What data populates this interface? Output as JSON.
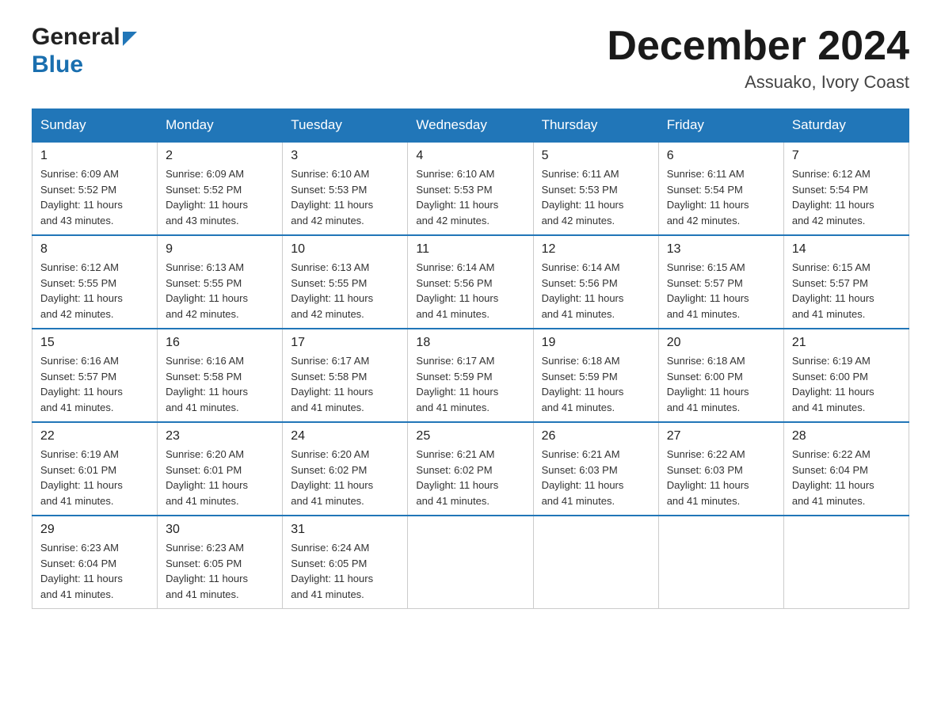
{
  "logo": {
    "general": "General",
    "blue": "Blue"
  },
  "header": {
    "month": "December 2024",
    "location": "Assuako, Ivory Coast"
  },
  "weekdays": [
    "Sunday",
    "Monday",
    "Tuesday",
    "Wednesday",
    "Thursday",
    "Friday",
    "Saturday"
  ],
  "weeks": [
    [
      {
        "day": "1",
        "sunrise": "6:09 AM",
        "sunset": "5:52 PM",
        "daylight": "11 hours and 43 minutes."
      },
      {
        "day": "2",
        "sunrise": "6:09 AM",
        "sunset": "5:52 PM",
        "daylight": "11 hours and 43 minutes."
      },
      {
        "day": "3",
        "sunrise": "6:10 AM",
        "sunset": "5:53 PM",
        "daylight": "11 hours and 42 minutes."
      },
      {
        "day": "4",
        "sunrise": "6:10 AM",
        "sunset": "5:53 PM",
        "daylight": "11 hours and 42 minutes."
      },
      {
        "day": "5",
        "sunrise": "6:11 AM",
        "sunset": "5:53 PM",
        "daylight": "11 hours and 42 minutes."
      },
      {
        "day": "6",
        "sunrise": "6:11 AM",
        "sunset": "5:54 PM",
        "daylight": "11 hours and 42 minutes."
      },
      {
        "day": "7",
        "sunrise": "6:12 AM",
        "sunset": "5:54 PM",
        "daylight": "11 hours and 42 minutes."
      }
    ],
    [
      {
        "day": "8",
        "sunrise": "6:12 AM",
        "sunset": "5:55 PM",
        "daylight": "11 hours and 42 minutes."
      },
      {
        "day": "9",
        "sunrise": "6:13 AM",
        "sunset": "5:55 PM",
        "daylight": "11 hours and 42 minutes."
      },
      {
        "day": "10",
        "sunrise": "6:13 AM",
        "sunset": "5:55 PM",
        "daylight": "11 hours and 42 minutes."
      },
      {
        "day": "11",
        "sunrise": "6:14 AM",
        "sunset": "5:56 PM",
        "daylight": "11 hours and 41 minutes."
      },
      {
        "day": "12",
        "sunrise": "6:14 AM",
        "sunset": "5:56 PM",
        "daylight": "11 hours and 41 minutes."
      },
      {
        "day": "13",
        "sunrise": "6:15 AM",
        "sunset": "5:57 PM",
        "daylight": "11 hours and 41 minutes."
      },
      {
        "day": "14",
        "sunrise": "6:15 AM",
        "sunset": "5:57 PM",
        "daylight": "11 hours and 41 minutes."
      }
    ],
    [
      {
        "day": "15",
        "sunrise": "6:16 AM",
        "sunset": "5:57 PM",
        "daylight": "11 hours and 41 minutes."
      },
      {
        "day": "16",
        "sunrise": "6:16 AM",
        "sunset": "5:58 PM",
        "daylight": "11 hours and 41 minutes."
      },
      {
        "day": "17",
        "sunrise": "6:17 AM",
        "sunset": "5:58 PM",
        "daylight": "11 hours and 41 minutes."
      },
      {
        "day": "18",
        "sunrise": "6:17 AM",
        "sunset": "5:59 PM",
        "daylight": "11 hours and 41 minutes."
      },
      {
        "day": "19",
        "sunrise": "6:18 AM",
        "sunset": "5:59 PM",
        "daylight": "11 hours and 41 minutes."
      },
      {
        "day": "20",
        "sunrise": "6:18 AM",
        "sunset": "6:00 PM",
        "daylight": "11 hours and 41 minutes."
      },
      {
        "day": "21",
        "sunrise": "6:19 AM",
        "sunset": "6:00 PM",
        "daylight": "11 hours and 41 minutes."
      }
    ],
    [
      {
        "day": "22",
        "sunrise": "6:19 AM",
        "sunset": "6:01 PM",
        "daylight": "11 hours and 41 minutes."
      },
      {
        "day": "23",
        "sunrise": "6:20 AM",
        "sunset": "6:01 PM",
        "daylight": "11 hours and 41 minutes."
      },
      {
        "day": "24",
        "sunrise": "6:20 AM",
        "sunset": "6:02 PM",
        "daylight": "11 hours and 41 minutes."
      },
      {
        "day": "25",
        "sunrise": "6:21 AM",
        "sunset": "6:02 PM",
        "daylight": "11 hours and 41 minutes."
      },
      {
        "day": "26",
        "sunrise": "6:21 AM",
        "sunset": "6:03 PM",
        "daylight": "11 hours and 41 minutes."
      },
      {
        "day": "27",
        "sunrise": "6:22 AM",
        "sunset": "6:03 PM",
        "daylight": "11 hours and 41 minutes."
      },
      {
        "day": "28",
        "sunrise": "6:22 AM",
        "sunset": "6:04 PM",
        "daylight": "11 hours and 41 minutes."
      }
    ],
    [
      {
        "day": "29",
        "sunrise": "6:23 AM",
        "sunset": "6:04 PM",
        "daylight": "11 hours and 41 minutes."
      },
      {
        "day": "30",
        "sunrise": "6:23 AM",
        "sunset": "6:05 PM",
        "daylight": "11 hours and 41 minutes."
      },
      {
        "day": "31",
        "sunrise": "6:24 AM",
        "sunset": "6:05 PM",
        "daylight": "11 hours and 41 minutes."
      },
      null,
      null,
      null,
      null
    ]
  ],
  "labels": {
    "sunrise": "Sunrise:",
    "sunset": "Sunset:",
    "daylight": "Daylight:"
  }
}
